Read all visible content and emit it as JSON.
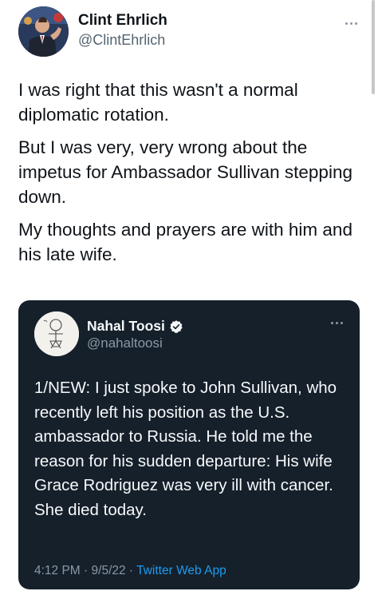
{
  "author": {
    "name": "Clint Ehrlich",
    "handle": "@ClintEhrlich",
    "avatar_icon": "profile-photo"
  },
  "tweet": {
    "paragraphs": [
      "I was right that this wasn't a normal diplomatic rotation.",
      "But I was very, very wrong about the impetus for Ambassador Sullivan stepping down.",
      "My thoughts and prayers are with him and his late wife."
    ]
  },
  "quoted_tweet": {
    "name": "Nahal Toosi",
    "handle": "@nahaltoosi",
    "verified_icon": "verified-badge-icon",
    "text": "1/NEW: I just spoke to John Sullivan, who recently left his position as the U.S. ambassador to Russia. He told me the reason for his sudden departure: His wife Grace Rodriguez was very ill with cancer. She died today.",
    "time": "4:12 PM",
    "date": "9/5/22",
    "separator": " · ",
    "source": "Twitter Web App"
  },
  "colors": {
    "primary_text": "#0f1419",
    "secondary_text": "#536471",
    "quote_background": "#15202b",
    "accent": "#1d9bf0"
  }
}
